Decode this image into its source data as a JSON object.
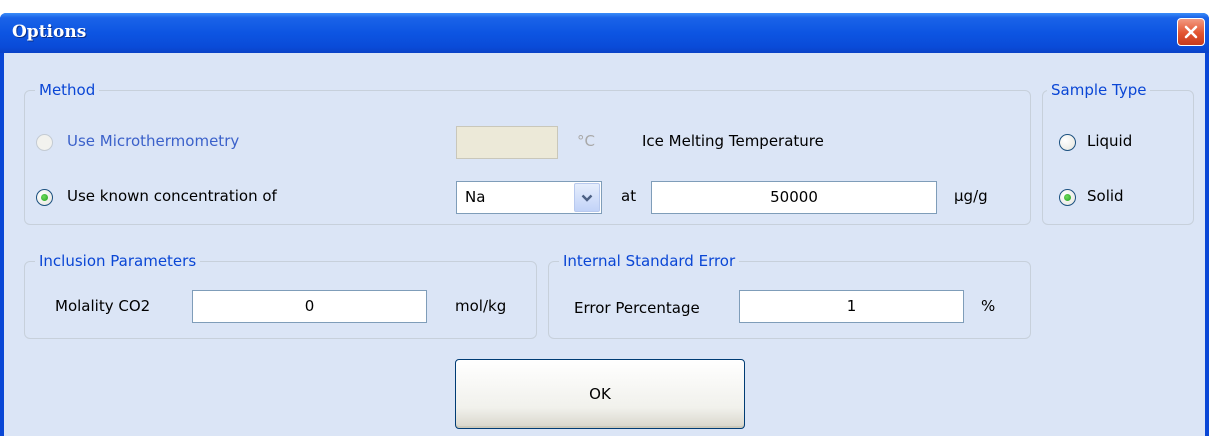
{
  "window": {
    "title": "Options"
  },
  "method": {
    "legend": "Method",
    "microthermometry_label": "Use Microthermometry",
    "temperature_value": "",
    "temperature_unit": "°C",
    "ice_melting_label": "Ice Melting Temperature",
    "known_concentration_label": "Use known concentration of",
    "element_selected": "Na",
    "at_label": "at",
    "concentration_value": "50000",
    "concentration_unit": "µg/g"
  },
  "sample_type": {
    "legend": "Sample Type",
    "liquid_label": "Liquid",
    "solid_label": "Solid",
    "selected": "Solid"
  },
  "inclusion": {
    "legend": "Inclusion Parameters",
    "molality_label": "Molality CO2",
    "molality_value": "0",
    "molality_unit": "mol/kg"
  },
  "internal_standard": {
    "legend": "Internal Standard Error",
    "error_label": "Error Percentage",
    "error_value": "1",
    "error_unit": "%"
  },
  "buttons": {
    "ok_label": "OK"
  },
  "colors": {
    "titlebar": "#0d55e2",
    "client_bg": "#dbe5f6",
    "legend_text": "#0a46d5",
    "close_button": "#e25430",
    "radio_dot": "#21a121"
  }
}
